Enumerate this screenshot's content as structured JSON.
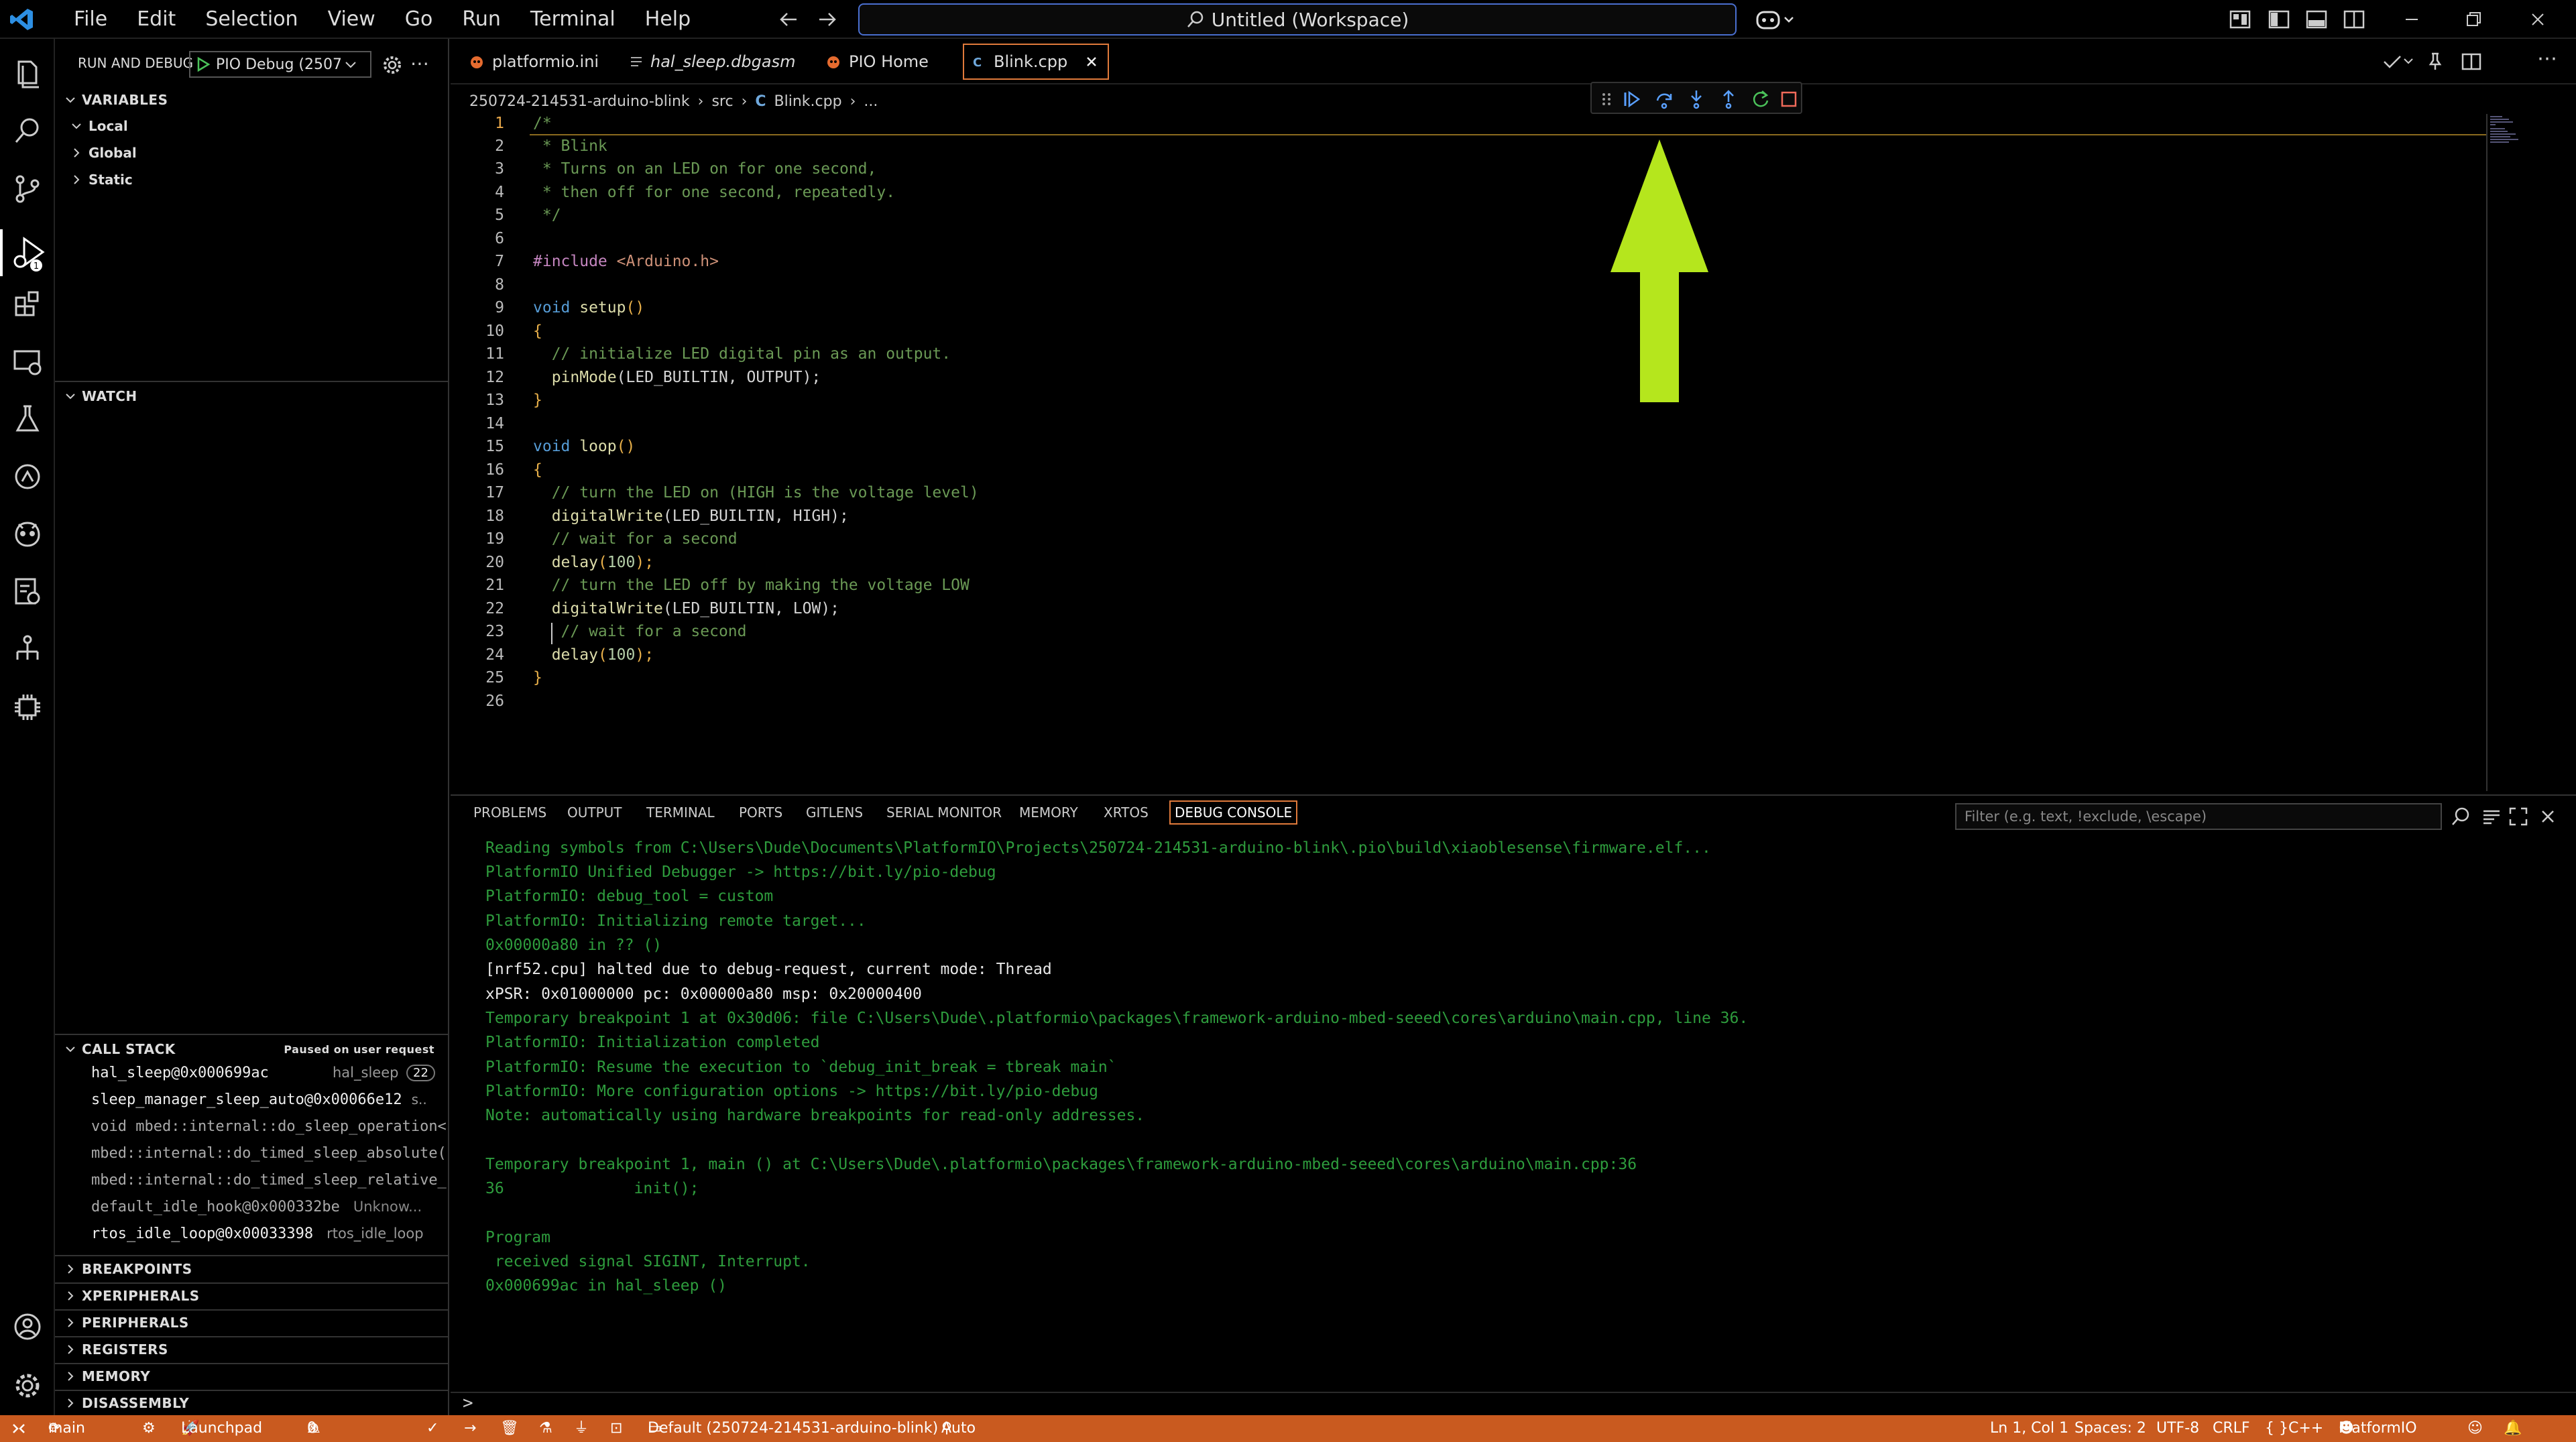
{
  "menu": [
    "File",
    "Edit",
    "Selection",
    "View",
    "Go",
    "Run",
    "Terminal",
    "Help"
  ],
  "search": {
    "title": "Untitled (Workspace)"
  },
  "sidebar": {
    "title": "RUN AND DEBUG",
    "config": "PIO Debug (2507:",
    "variables": {
      "header": "VARIABLES",
      "items": [
        "Local",
        "Global",
        "Static"
      ]
    },
    "watch": {
      "header": "WATCH"
    },
    "callstack": {
      "header": "CALL STACK",
      "status": "Paused on user request",
      "frames": [
        {
          "name": "hal_sleep@0x000699ac",
          "file": "hal_sleep",
          "badge": "22"
        },
        {
          "name": "sleep_manager_sleep_auto@0x00066e12",
          "file": "s.."
        },
        {
          "name": "void mbed::internal::do_sleep_operation<m",
          "file": ""
        },
        {
          "name": "mbed::internal::do_timed_sleep_absolute(s",
          "file": ""
        },
        {
          "name": "mbed::internal::do_timed_sleep_relative_t",
          "file": ""
        },
        {
          "name": "default_idle_hook@0x000332be",
          "file": "Unknow..."
        },
        {
          "name": "rtos_idle_loop@0x00033398",
          "file": "rtos_idle_loop"
        }
      ]
    },
    "sections": [
      "BREAKPOINTS",
      "XPERIPHERALS",
      "PERIPHERALS",
      "REGISTERS",
      "MEMORY",
      "DISASSEMBLY"
    ]
  },
  "tabs": [
    {
      "label": "platformio.ini"
    },
    {
      "label": "hal_sleep.dbgasm"
    },
    {
      "label": "PIO Home"
    },
    {
      "label": "Blink.cpp"
    }
  ],
  "breadcrumb": {
    "folder": "250724-214531-arduino-blink",
    "src": "src",
    "file": "Blink.cpp",
    "more": "..."
  },
  "code": {
    "lines": [
      "1",
      "2",
      "3",
      "4",
      "5",
      "6",
      "7",
      "8",
      "9",
      "10",
      "11",
      "12",
      "13",
      "14",
      "15",
      "16",
      "17",
      "18",
      "19",
      "20",
      "21",
      "22",
      "23",
      "24",
      "25",
      "26"
    ],
    "l1": "/*",
    "l2": " * Blink",
    "l3": " * Turns on an LED on for one second,",
    "l4": " * then off for one second, repeatedly.",
    "l5": " */",
    "l7_kw": "#include",
    "l7_inc": " <Arduino.h>",
    "l9_kw": "void",
    "l9_fn": " setup",
    "l9_p": "()",
    "l10": "{",
    "l11": "  // initialize LED digital pin as an output.",
    "l12_fn": "  pinMode",
    "l12_rest": "(LED_BUILTIN, OUTPUT);",
    "l13": "}",
    "l15_kw": "void",
    "l15_fn": " loop",
    "l15_p": "()",
    "l16": "{",
    "l17": "  // turn the LED on (HIGH is the voltage level)",
    "l18_fn": "  digitalWrite",
    "l18_rest": "(LED_BUILTIN, HIGH);",
    "l19": "  // wait for a second",
    "l20_fn": "  delay",
    "l20_a": "(",
    "l20_n": "100",
    "l20_b": ");",
    "l21": "  // turn the LED off by making the voltage LOW",
    "l22_fn": "  digitalWrite",
    "l22_rest": "(LED_BUILTIN, LOW);",
    "l23": "   // wait for a second",
    "l24_fn": "  delay",
    "l24_a": "(",
    "l24_n": "100",
    "l24_b": ");",
    "l25": "}"
  },
  "panel": {
    "tabs": [
      "PROBLEMS",
      "OUTPUT",
      "TERMINAL",
      "PORTS",
      "GITLENS",
      "SERIAL MONITOR",
      "MEMORY",
      "XRTOS",
      "DEBUG CONSOLE"
    ],
    "filter_placeholder": "Filter (e.g. text, !exclude, \\escape)",
    "console": [
      {
        "t": "Reading symbols from C:\\Users\\Dude\\Documents\\PlatformIO\\Projects\\250724-214531-arduino-blink\\.pio\\build\\xiaoblesense\\firmware.elf...",
        "c": "g"
      },
      {
        "t": "PlatformIO Unified Debugger -> https://bit.ly/pio-debug",
        "c": "g"
      },
      {
        "t": "PlatformIO: debug_tool = custom",
        "c": "g"
      },
      {
        "t": "PlatformIO: Initializing remote target...",
        "c": "g"
      },
      {
        "t": "0x00000a80 in ?? ()",
        "c": "g"
      },
      {
        "t": "[nrf52.cpu] halted due to debug-request, current mode: Thread",
        "c": "w"
      },
      {
        "t": "xPSR: 0x01000000 pc: 0x00000a80 msp: 0x20000400",
        "c": "w"
      },
      {
        "t": "Temporary breakpoint 1 at 0x30d06: file C:\\Users\\Dude\\.platformio\\packages\\framework-arduino-mbed-seeed\\cores\\arduino\\main.cpp, line 36.",
        "c": "g"
      },
      {
        "t": "PlatformIO: Initialization completed",
        "c": "g"
      },
      {
        "t": "PlatformIO: Resume the execution to `debug_init_break = tbreak main`",
        "c": "g"
      },
      {
        "t": "PlatformIO: More configuration options -> https://bit.ly/pio-debug",
        "c": "g"
      },
      {
        "t": "Note: automatically using hardware breakpoints for read-only addresses.",
        "c": "g"
      },
      {
        "t": "",
        "c": "g"
      },
      {
        "t": "Temporary breakpoint 1, main () at C:\\Users\\Dude\\.platformio\\packages\\framework-arduino-mbed-seeed\\cores\\arduino\\main.cpp:36",
        "c": "g"
      },
      {
        "t": "36              init();",
        "c": "g"
      },
      {
        "t": "",
        "c": "g"
      },
      {
        "t": "Program",
        "c": "g"
      },
      {
        "t": " received signal SIGINT, Interrupt.",
        "c": "g"
      },
      {
        "t": "0x000699ac in hal_sleep ()",
        "c": "g"
      }
    ],
    "prompt": ">"
  },
  "status": {
    "branch": "main",
    "launchpad": "Launchpad",
    "problems": "0",
    "warnings": "0",
    "env": "Default (250724-214531-arduino-blink)",
    "auto": "Auto",
    "position": "Ln 1, Col 1",
    "spaces": "Spaces: 2",
    "encoding": "UTF-8",
    "eol": "CRLF",
    "language": "C++",
    "platformio": "PlatformIO"
  },
  "colors": {
    "accent": "#c95a1f",
    "arrow": "#b5e61d",
    "console_green": "#2e9c3d"
  }
}
